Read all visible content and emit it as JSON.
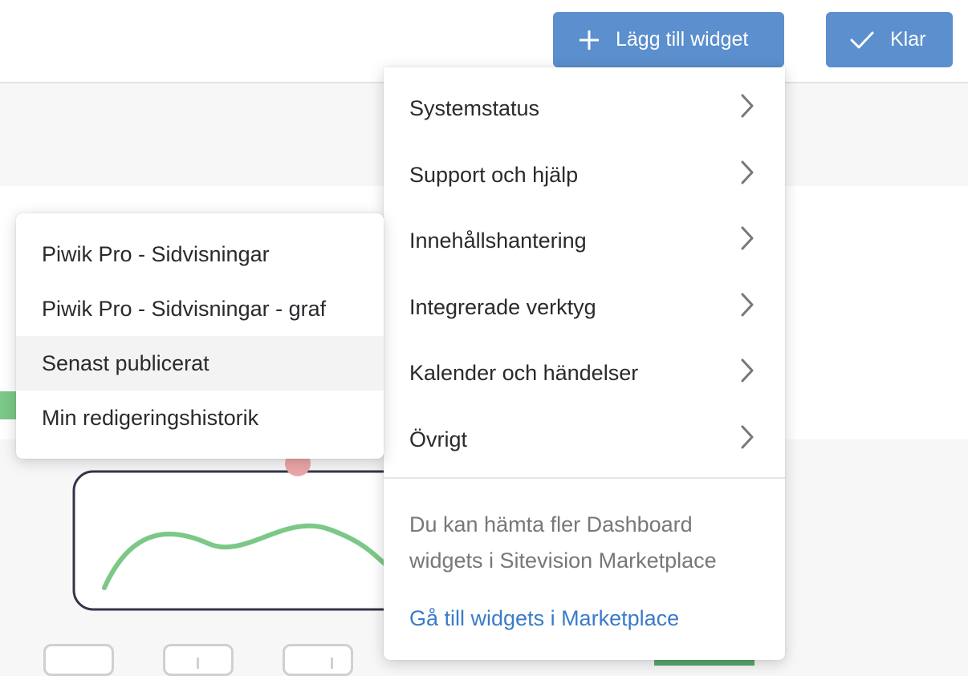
{
  "toolbar": {
    "add_widget_label": "Lägg till widget",
    "add_icon": "plus-icon",
    "done_label": "Klar",
    "done_icon": "check-icon",
    "button_color": "#5b8fcd"
  },
  "widget_menu": {
    "categories": [
      {
        "label": "Systemstatus"
      },
      {
        "label": "Support och hjälp"
      },
      {
        "label": "Innehållshantering"
      },
      {
        "label": "Integrerade verktyg"
      },
      {
        "label": "Kalender och händelser"
      },
      {
        "label": "Övrigt"
      }
    ],
    "chevron_icon": "chevron-right-icon",
    "info_text": "Du kan hämta fler Dashboard widgets i Sitevision Marketplace",
    "marketplace_link": "Gå till widgets i Marketplace",
    "link_color": "#3a7bc8"
  },
  "submenu": {
    "items": [
      {
        "label": "Piwik Pro - Sidvisningar"
      },
      {
        "label": "Piwik Pro - Sidvisningar - graf"
      },
      {
        "label": "Senast publicerat",
        "highlighted": true
      },
      {
        "label": "Min redigeringshistorik"
      }
    ]
  },
  "background": {
    "illustration": "chart-illustration",
    "accent_green": "#7cc887"
  }
}
